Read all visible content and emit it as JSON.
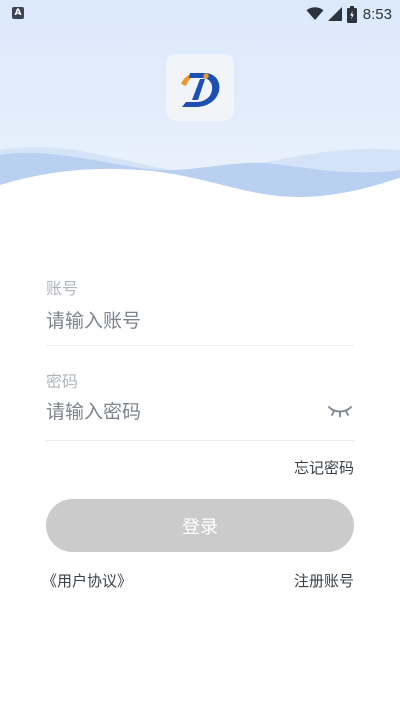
{
  "status_bar": {
    "notification_badge": "A",
    "time": "8:53",
    "icons": [
      "wifi-icon",
      "signal-icon",
      "battery-icon"
    ]
  },
  "app": {
    "logo_icon": "app-logo-icon"
  },
  "form": {
    "account": {
      "label": "账号",
      "placeholder": "请输入账号",
      "value": ""
    },
    "password": {
      "label": "密码",
      "placeholder": "请输入密码",
      "value": "",
      "toggle_icon": "eye-closed-icon"
    },
    "forgot_password": "忘记密码",
    "login_button": "登录",
    "user_agreement": "《用户协议》",
    "register_account": "注册账号"
  },
  "colors": {
    "header_bg": "#dce9fb",
    "wave_light": "#c5d9f4",
    "wave_dark": "#a9c6ef",
    "button_disabled": "#cbcbcb",
    "label_gray": "#b0b4bb",
    "placeholder_gray": "#7f848c",
    "logo_blue": "#1e4fb3",
    "logo_orange": "#f0962f"
  }
}
